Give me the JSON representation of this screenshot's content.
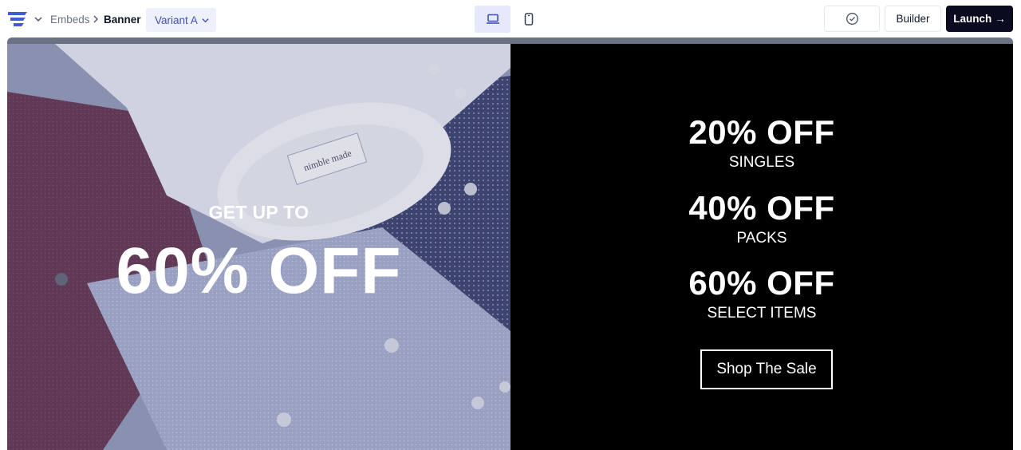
{
  "breadcrumb": {
    "root": "Embeds",
    "current": "Banner"
  },
  "variant": {
    "label": "Variant A"
  },
  "toolbar": {
    "builder_label": "Builder",
    "launch_label": "Launch",
    "launch_arrow": "→"
  },
  "icons": {
    "logo": "brand-logo-icon",
    "caret": "chevron-down-icon",
    "desktop": "laptop-icon",
    "mobile": "mobile-phone-icon",
    "check": "check-circle-icon"
  },
  "colors": {
    "accent": "#3f51b5",
    "launch_bg": "#0b0b1f",
    "banner_right_bg": "#000000"
  },
  "banner": {
    "left": {
      "kicker": "GET UP TO",
      "headline": "60% OFF",
      "shirt_label": "nimble made"
    },
    "right": {
      "deals": [
        {
          "percent": "20% OFF",
          "label": "SINGLES"
        },
        {
          "percent": "40% OFF",
          "label": "PACKS"
        },
        {
          "percent": "60% OFF",
          "label": "SELECT ITEMS"
        }
      ],
      "cta": "Shop The Sale"
    }
  }
}
